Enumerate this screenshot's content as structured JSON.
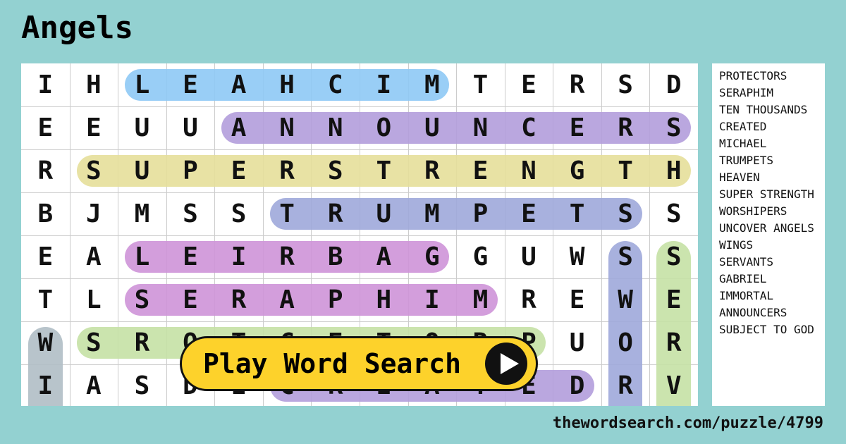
{
  "title": "Angels",
  "grid": [
    "IHLEAHCIMTERSD",
    "EEUUANNOUNCERS",
    "RSUPERSTRENGTH",
    "BJMSSTRUMPETSS",
    "EALEIRBAGGUWSS",
    "TLSERAPHIMREWE",
    "WSROTCETORPUOR",
    "IASDECREATEDRV"
  ],
  "highlights": [
    {
      "word": "MICHAEL",
      "row": 0,
      "c1": 2,
      "c2": 8,
      "dir": "h",
      "color": "#8ec9f5"
    },
    {
      "word": "ANNOUNCERS",
      "row": 1,
      "c1": 4,
      "c2": 13,
      "dir": "h",
      "color": "#b39ddb"
    },
    {
      "word": "SUPER STRENGTH",
      "row": 2,
      "c1": 1,
      "c2": 13,
      "dir": "h",
      "color": "#e6df9a"
    },
    {
      "word": "TRUMPETS",
      "row": 3,
      "c1": 5,
      "c2": 12,
      "dir": "h",
      "color": "#9fa8da"
    },
    {
      "word": "GABRIEL",
      "row": 4,
      "c1": 2,
      "c2": 8,
      "dir": "h",
      "color": "#ce93d8"
    },
    {
      "word": "SERAPHIM",
      "row": 5,
      "c1": 2,
      "c2": 9,
      "dir": "h",
      "color": "#ce93d8"
    },
    {
      "word": "PROTECTORS",
      "row": 6,
      "c1": 1,
      "c2": 10,
      "dir": "h",
      "color": "#c5e1a5"
    },
    {
      "word": "CREATED",
      "row": 7,
      "c1": 5,
      "c2": 11,
      "dir": "h",
      "color": "#b39ddb"
    },
    {
      "word": "WINGS",
      "col": 0,
      "r1": 6,
      "r2": 9,
      "dir": "v",
      "color": "#b0bec5"
    },
    {
      "word": "WORSHIPERS",
      "col": 12,
      "r1": 4,
      "r2": 9,
      "dir": "v",
      "color": "#9fa8da"
    },
    {
      "word": "SERVANTS",
      "col": 13,
      "r1": 4,
      "r2": 9,
      "dir": "v",
      "color": "#c5e1a5"
    }
  ],
  "words": [
    "PROTECTORS",
    "SERAPHIM",
    "TEN THOUSANDS",
    "CREATED",
    "MICHAEL",
    "TRUMPETS",
    "HEAVEN",
    "SUPER STRENGTH",
    "WORSHIPERS",
    "UNCOVER ANGELS",
    "WINGS",
    "SERVANTS",
    "GABRIEL",
    "IMMORTAL",
    "ANNOUNCERS",
    "SUBJECT TO GOD"
  ],
  "play_label": "Play Word Search",
  "url": "thewordsearch.com/puzzle/4799"
}
